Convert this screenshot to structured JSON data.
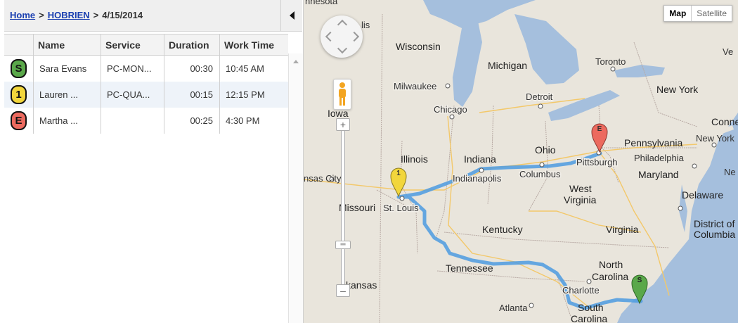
{
  "breadcrumb": {
    "home": "Home",
    "sep1": ">",
    "user": "HOBRIEN",
    "sep2": ">",
    "date": "4/15/2014"
  },
  "columns": [
    "",
    "Name",
    "Service",
    "Duration",
    "Work Time"
  ],
  "rows": [
    {
      "badge": "S",
      "badge_color": "#5aa84a",
      "name": "Sara Evans",
      "service": "PC-MON...",
      "duration": "00:30",
      "time": "10:45 AM"
    },
    {
      "badge": "1",
      "badge_color": "#f2d63c",
      "name": "Lauren ...",
      "service": "PC-QUA...",
      "duration": "00:15",
      "time": "12:15 PM"
    },
    {
      "badge": "E",
      "badge_color": "#ec6a5f",
      "name": "Martha ...",
      "service": "",
      "duration": "00:25",
      "time": "4:30 PM"
    }
  ],
  "map": {
    "type_map": "Map",
    "type_satellite": "Satellite",
    "zoom_in": "+",
    "zoom_out": "–",
    "markers": [
      {
        "label": "S",
        "color": "#5aa84a"
      },
      {
        "label": "1",
        "color": "#f2d63c"
      },
      {
        "label": "E",
        "color": "#ec6a5f"
      }
    ],
    "labels": {
      "nnesota": "nnesota",
      "wisconsin": "Wisconsin",
      "michigan": "Michigan",
      "toronto": "Toronto",
      "milwaukee": "Milwaukee",
      "detroit": "Detroit",
      "newyork": "New York",
      "iowa": "Iowa",
      "chicago": "Chicago",
      "conne": "Conne",
      "pennsylvania": "Pennsylvania",
      "newyork_city": "New York",
      "illinois": "Illinois",
      "indiana": "Indiana",
      "ohio": "Ohio",
      "pittsburgh": "Pittsburgh",
      "philadelphia": "Philadelphia",
      "kansascity": "nsas City",
      "columbus": "Columbus",
      "indianapolis": "Indianapolis",
      "maryland": "Maryland",
      "ne": "Ne",
      "westvirginia1": "West",
      "westvirginia2": "Virginia",
      "delaware": "Delaware",
      "missouri": "Missouri",
      "stlouis": "St. Louis",
      "districtof": "District of",
      "columbia": "Columbia",
      "kentucky": "Kentucky",
      "virginia": "Virginia",
      "tennessee": "Tennessee",
      "northcarolina1": "North",
      "northcarolina2": "Carolina",
      "arkansas": "kansas",
      "charlotte": "Charlotte",
      "atlanta": "Atlanta",
      "southcarolina1": "South",
      "southcarolina2": "Carolina",
      "ve": "Ve",
      "lis": "lis"
    }
  }
}
